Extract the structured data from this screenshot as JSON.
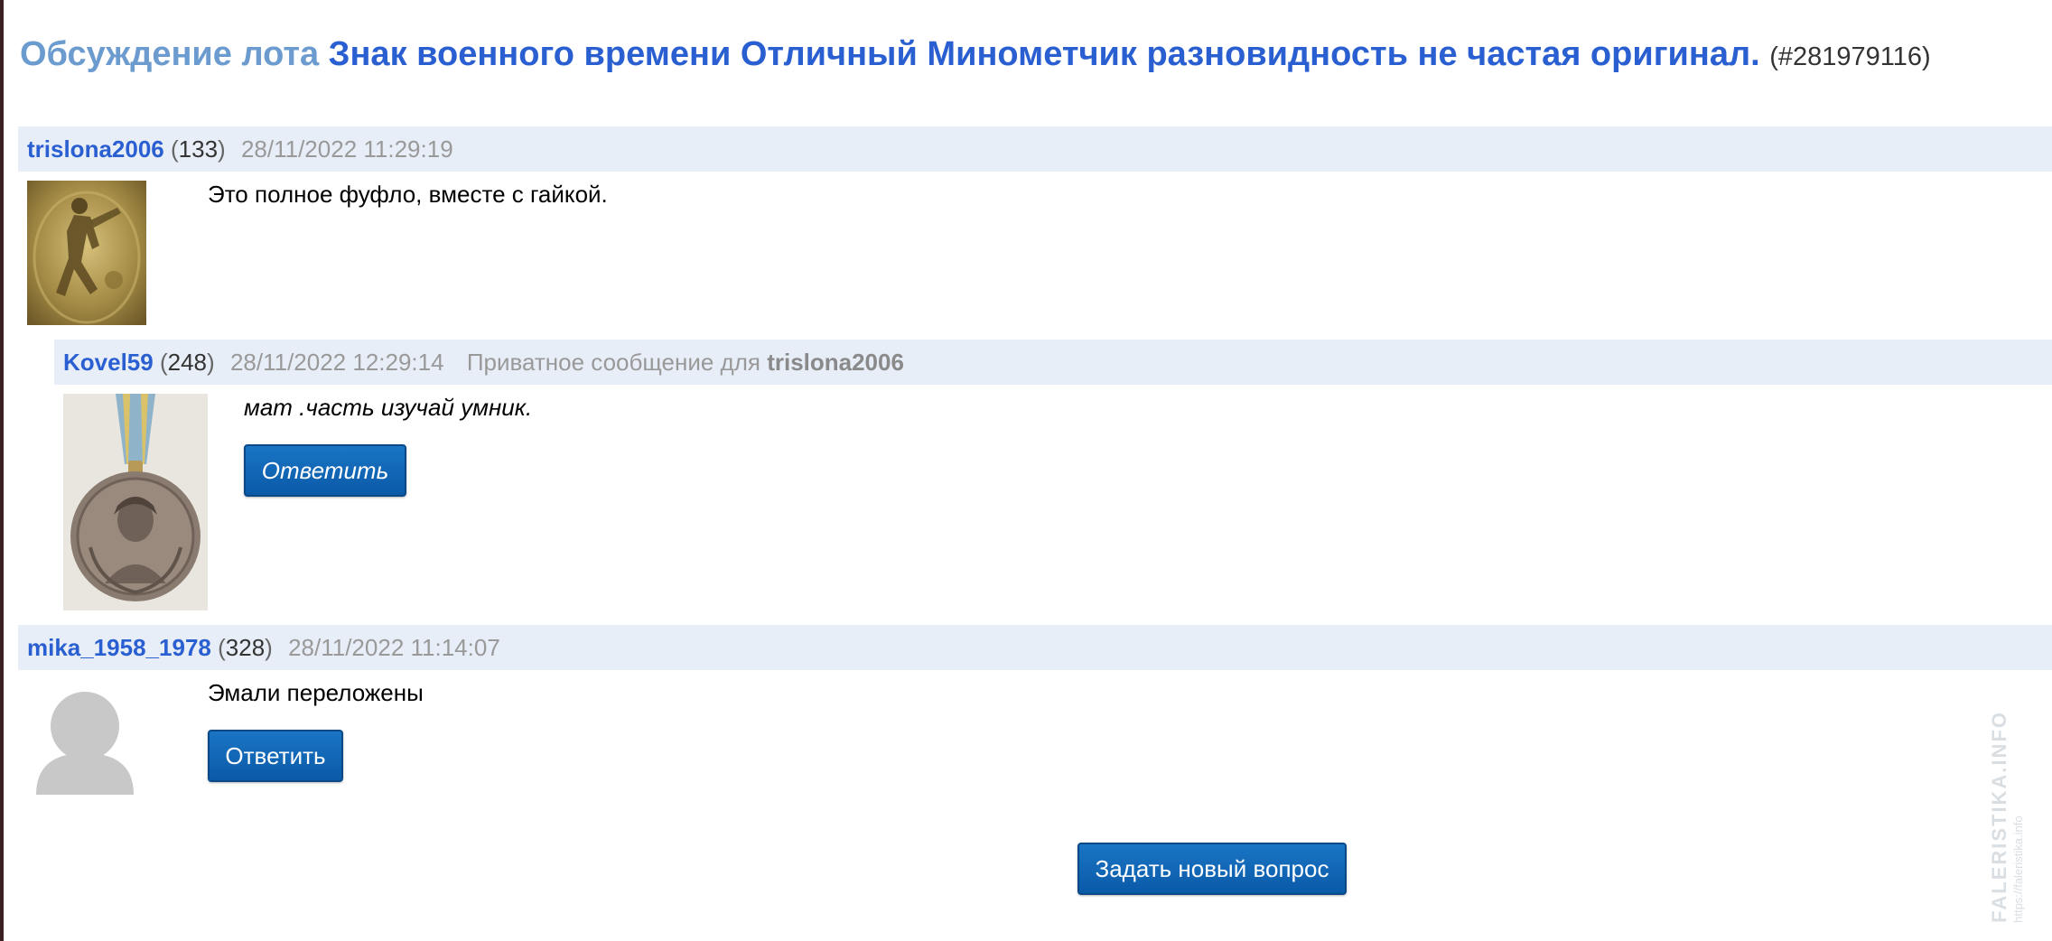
{
  "title": {
    "prefix": "Обсуждение лота",
    "lot_name": "Знак военного времени Отличный Минометчик разновидность не частая оригинал.",
    "lot_id": "(#281979116)"
  },
  "messages": [
    {
      "user": "trislona2006",
      "rating_open": "(",
      "rating": "133",
      "rating_close": ")",
      "date": "28/11/2022 11:29:19",
      "text": "Это полное фуфло, вместе с гайкой.",
      "avatar": "badge-photo-icon"
    },
    {
      "user": "Kovel59",
      "rating_open": "(",
      "rating": "248",
      "rating_close": ")",
      "date": "28/11/2022 12:29:14",
      "private_prefix": "Приватное сообщение для",
      "private_to": "trislona2006",
      "text": "мат .часть изучай умник.",
      "reply_label": "Ответить",
      "avatar": "medal-photo-icon"
    },
    {
      "user": "mika_1958_1978",
      "rating_open": "(",
      "rating": "328",
      "rating_close": ")",
      "date": "28/11/2022 11:14:07",
      "text": "Эмали переложены",
      "reply_label": "Ответить",
      "avatar": "default-user-icon"
    }
  ],
  "new_question_label": "Задать новый вопрос",
  "watermark": {
    "main": "FALERISTIKA.INFO",
    "sub": "https://faleristika.info"
  },
  "colors": {
    "link": "#2a5fd1",
    "title_prefix": "#6b9bcf",
    "header_bg": "#e8eef7",
    "button": "#0a5aa8"
  }
}
